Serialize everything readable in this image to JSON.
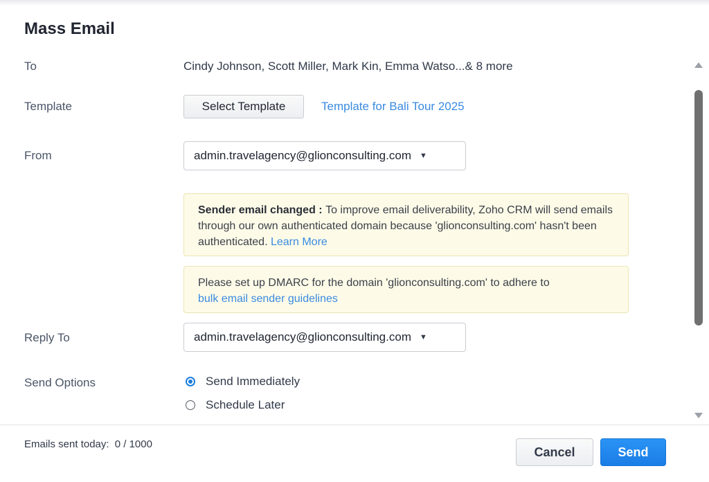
{
  "dialog": {
    "title": "Mass Email"
  },
  "to": {
    "label": "To",
    "value": "Cindy Johnson, Scott Miller, Mark Kin, Emma Watso...& 8 more"
  },
  "template": {
    "label": "Template",
    "button": "Select Template",
    "selected": "Template for Bali Tour 2025"
  },
  "from": {
    "label": "From",
    "value": "admin.travelagency@glionconsulting.com",
    "caret_icon": "caret-down-icon"
  },
  "notices": {
    "sender_changed": {
      "heading": "Sender email changed",
      "separator": " : ",
      "body": "To improve email deliverability, Zoho CRM will send emails through our own authenticated domain because 'glionconsulting.com' hasn't been authenticated.",
      "link": "Learn More"
    },
    "dmarc": {
      "body": "Please set up DMARC for the domain 'glionconsulting.com' to adhere to",
      "link": "bulk email sender guidelines"
    }
  },
  "reply_to": {
    "label": "Reply To",
    "value": "admin.travelagency@glionconsulting.com",
    "caret_icon": "caret-down-icon"
  },
  "send_options": {
    "label": "Send Options",
    "options": [
      {
        "label": "Send Immediately",
        "selected": true
      },
      {
        "label": "Schedule Later",
        "selected": false
      }
    ]
  },
  "footer": {
    "emails_sent_label": "Emails sent today:",
    "emails_sent_value": "0 / 1000",
    "cancel": "Cancel",
    "send": "Send"
  },
  "colors": {
    "accent": "#1a7de6",
    "link": "#3a8ae0",
    "notice_bg": "#fdfbe8"
  }
}
